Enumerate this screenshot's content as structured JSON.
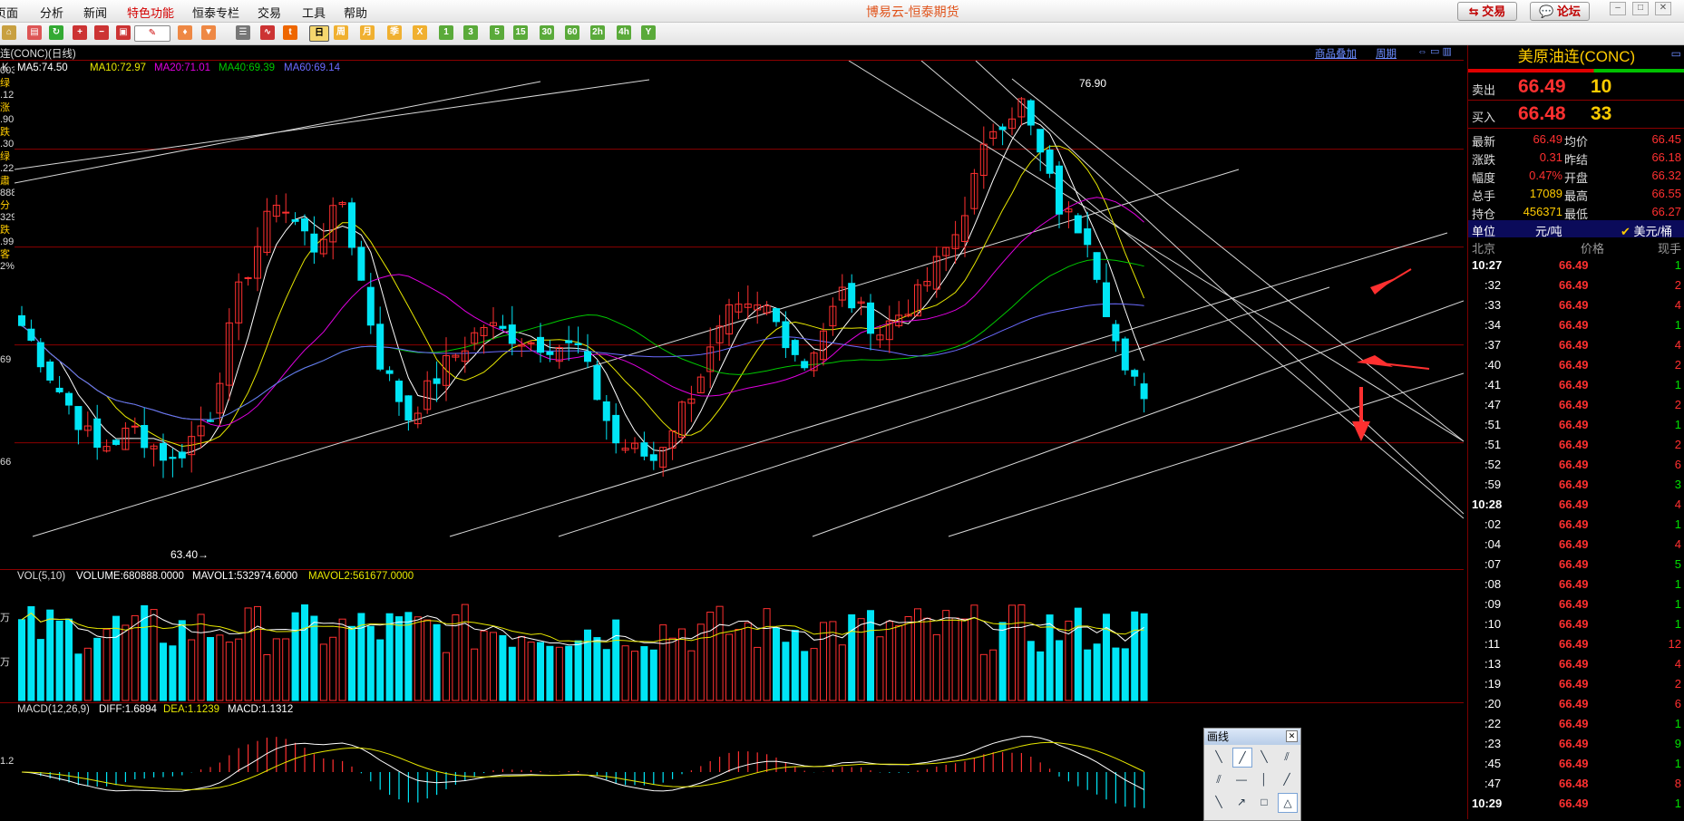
{
  "menu": [
    "页面",
    "分析",
    "新闻",
    "特色功能",
    "恒泰专栏",
    "交易",
    "工具",
    "帮助"
  ],
  "app_title": "博易云-恒泰期货",
  "top_buttons": {
    "trade": "交易",
    "forum": "论坛"
  },
  "toolbar_labels": [
    "周",
    "月",
    "季",
    "X",
    "1",
    "3",
    "5",
    "15",
    "30",
    "60",
    "2h",
    "4h",
    "Y"
  ],
  "chart": {
    "symbol_caption": "连(CONC)(日线)",
    "links": {
      "product_add": "商品叠加",
      "period": "周期"
    },
    "ma": {
      "k": "K",
      "ma5": "MA5:74.50",
      "ma10": "MA10:72.97",
      "ma20": "MA20:71.01",
      "ma40": "MA40:69.39",
      "ma60": "MA60:69.14"
    },
    "ma_colors": {
      "ma5": "#ffffff",
      "ma10": "#e8e800",
      "ma20": "#e000e0",
      "ma40": "#00c800",
      "ma60": "#6b6bff"
    },
    "y_labels": [
      "69",
      "66"
    ],
    "left_fragments": [
      "003",
      "绿",
      ".12",
      "涨",
      ".90",
      "跌",
      ".30",
      "绿",
      ".22",
      "肅",
      "888",
      "分",
      "329",
      "跌",
      ".99",
      "客",
      "2%"
    ],
    "high_label": "76.90",
    "low_label": "63.40→",
    "vol": {
      "title": "VOL(5,10)",
      "volume": "VOLUME:680888.0000",
      "mavol1": "MAVOL1:532974.6000",
      "mavol2": "MAVOL2:561677.0000",
      "ylabels": [
        "万",
        "万"
      ]
    },
    "macd": {
      "title": "MACD(12,26,9)",
      "diff": "DIFF:1.6894",
      "dea": "DEA:1.1239",
      "macd": "MACD:1.1312",
      "ylabel": "1.2"
    },
    "colors": {
      "up": "#ff3030",
      "down": "#00e5f5",
      "grid": "#8b0000",
      "annot": "#ff3030"
    }
  },
  "drawing_toolbox": {
    "title": "画线"
  },
  "quote": {
    "title": "美原油连(CONC)",
    "ask_label": "卖出",
    "ask_price": "66.49",
    "ask_vol": "10",
    "bid_label": "买入",
    "bid_price": "66.48",
    "bid_vol": "33",
    "stats": [
      {
        "l1": "最新",
        "v1": "66.49",
        "l2": "均价",
        "v2": "66.45"
      },
      {
        "l1": "涨跌",
        "v1": "0.31",
        "l2": "昨结",
        "v2": "66.18"
      },
      {
        "l1": "幅度",
        "v1": "0.47%",
        "l2": "开盘",
        "v2": "66.32"
      },
      {
        "l1": "总手",
        "v1": "17089",
        "l2": "最高",
        "v2": "66.55"
      },
      {
        "l1": "持仓",
        "v1": "456371",
        "l2": "最低",
        "v2": "66.27"
      }
    ],
    "unit": {
      "label": "单位",
      "value": "元/吨",
      "alt": "美元/桶"
    },
    "tick_header": {
      "time": "北京",
      "price": "价格",
      "vol": "现手"
    },
    "ticks": [
      {
        "t": "10:27",
        "p": "66.49",
        "v": "1"
      },
      {
        "t": ":32",
        "p": "66.49",
        "v": "2"
      },
      {
        "t": ":33",
        "p": "66.49",
        "v": "4"
      },
      {
        "t": ":34",
        "p": "66.49",
        "v": "1"
      },
      {
        "t": ":37",
        "p": "66.49",
        "v": "4"
      },
      {
        "t": ":40",
        "p": "66.49",
        "v": "2"
      },
      {
        "t": ":41",
        "p": "66.49",
        "v": "1"
      },
      {
        "t": ":47",
        "p": "66.49",
        "v": "2"
      },
      {
        "t": ":51",
        "p": "66.49",
        "v": "1"
      },
      {
        "t": ":51",
        "p": "66.49",
        "v": "2"
      },
      {
        "t": ":52",
        "p": "66.49",
        "v": "6"
      },
      {
        "t": ":59",
        "p": "66.49",
        "v": "3"
      },
      {
        "t": "10:28",
        "p": "66.49",
        "v": "4"
      },
      {
        "t": ":02",
        "p": "66.49",
        "v": "1"
      },
      {
        "t": ":04",
        "p": "66.49",
        "v": "4"
      },
      {
        "t": ":07",
        "p": "66.49",
        "v": "5"
      },
      {
        "t": ":08",
        "p": "66.49",
        "v": "1"
      },
      {
        "t": ":09",
        "p": "66.49",
        "v": "1"
      },
      {
        "t": ":10",
        "p": "66.49",
        "v": "1"
      },
      {
        "t": ":11",
        "p": "66.49",
        "v": "12"
      },
      {
        "t": ":13",
        "p": "66.49",
        "v": "4"
      },
      {
        "t": ":19",
        "p": "66.49",
        "v": "2"
      },
      {
        "t": ":20",
        "p": "66.49",
        "v": "6"
      },
      {
        "t": ":22",
        "p": "66.49",
        "v": "1"
      },
      {
        "t": ":23",
        "p": "66.49",
        "v": "9"
      },
      {
        "t": ":45",
        "p": "66.49",
        "v": "1"
      },
      {
        "t": ":47",
        "p": "66.48",
        "v": "8"
      },
      {
        "t": "10:29",
        "p": "66.49",
        "v": "1"
      }
    ]
  }
}
